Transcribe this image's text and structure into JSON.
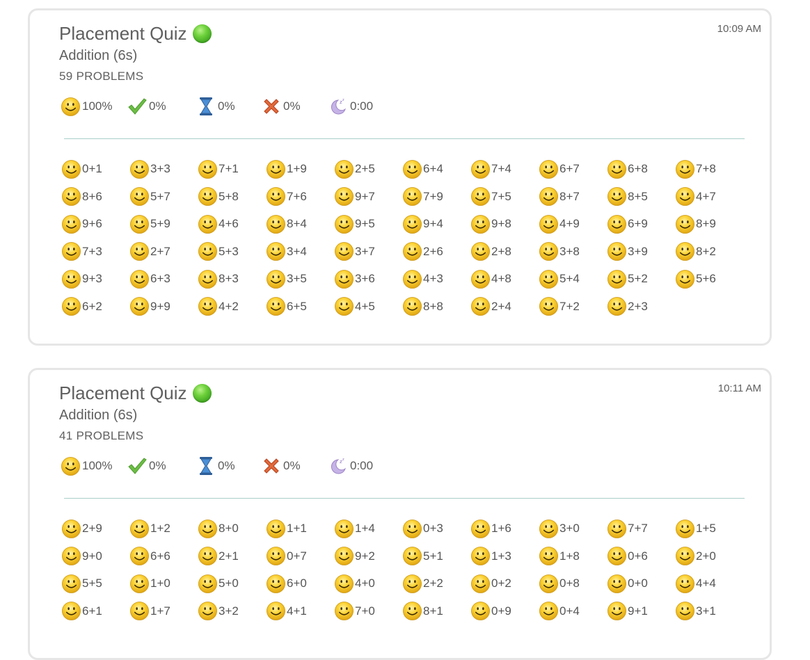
{
  "cards": [
    {
      "title": "Placement Quiz",
      "time": "10:09 AM",
      "subtitle": "Addition (6s)",
      "count": "59 PROBLEMS",
      "stats": {
        "smiley": "100%",
        "check": "0%",
        "hourglass": "0%",
        "cross": "0%",
        "time_icon": "0:00"
      },
      "problems": [
        "0+1",
        "3+3",
        "7+1",
        "1+9",
        "2+5",
        "6+4",
        "7+4",
        "6+7",
        "6+8",
        "7+8",
        "8+6",
        "5+7",
        "5+8",
        "7+6",
        "9+7",
        "7+9",
        "7+5",
        "8+7",
        "8+5",
        "4+7",
        "9+6",
        "5+9",
        "4+6",
        "8+4",
        "9+5",
        "9+4",
        "9+8",
        "4+9",
        "6+9",
        "8+9",
        "7+3",
        "2+7",
        "5+3",
        "3+4",
        "3+7",
        "2+6",
        "2+8",
        "3+8",
        "3+9",
        "8+2",
        "9+3",
        "6+3",
        "8+3",
        "3+5",
        "3+6",
        "4+3",
        "4+8",
        "5+4",
        "5+2",
        "5+6",
        "6+2",
        "9+9",
        "4+2",
        "6+5",
        "4+5",
        "8+8",
        "2+4",
        "7+2",
        "2+3"
      ]
    },
    {
      "title": "Placement Quiz",
      "time": "10:11 AM",
      "subtitle": "Addition (6s)",
      "count": "41 PROBLEMS",
      "stats": {
        "smiley": "100%",
        "check": "0%",
        "hourglass": "0%",
        "cross": "0%",
        "time_icon": "0:00"
      },
      "problems": [
        "2+9",
        "1+2",
        "8+0",
        "1+1",
        "1+4",
        "0+3",
        "1+6",
        "3+0",
        "7+7",
        "1+5",
        "9+0",
        "6+6",
        "2+1",
        "0+7",
        "9+2",
        "5+1",
        "1+3",
        "1+8",
        "0+6",
        "2+0",
        "5+5",
        "1+0",
        "5+0",
        "6+0",
        "4+0",
        "2+2",
        "0+2",
        "0+8",
        "0+0",
        "4+4",
        "6+1",
        "1+7",
        "3+2",
        "4+1",
        "7+0",
        "8+1",
        "0+9",
        "0+4",
        "9+1",
        "3+1"
      ]
    }
  ],
  "icons": {
    "status": "green-status-icon",
    "smiley": "smiley-icon",
    "check": "check-icon",
    "hourglass": "hourglass-icon",
    "cross": "cross-icon",
    "moon": "moon-sleep-icon"
  },
  "colors": {
    "status_green": "#4caf2a",
    "smiley_yellow": "#f5c518",
    "check_green": "#6cbd45",
    "hourglass_blue": "#3f7fc4",
    "cross_red": "#d9542c",
    "moon_purple": "#b9a4d8",
    "divider": "#a9cfc8"
  }
}
